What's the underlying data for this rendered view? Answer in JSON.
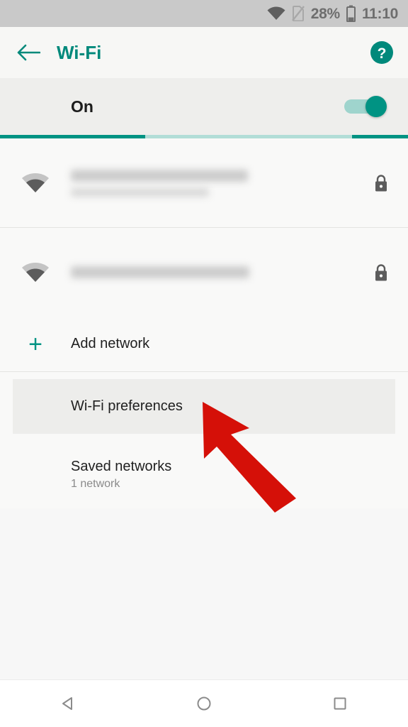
{
  "status_bar": {
    "wifi_icon": "wifi-icon",
    "sim_icon": "sim-card-off-icon",
    "battery_percent": "28%",
    "battery_icon": "battery-icon",
    "clock": "11:10"
  },
  "app_bar": {
    "back_icon": "arrow-back-icon",
    "title": "Wi-Fi",
    "help_icon": "help-circle-icon",
    "accent_color": "#00897b"
  },
  "master_switch": {
    "label": "On",
    "state": "on",
    "track_color": "#9fd4cd",
    "thumb_color": "#009383"
  },
  "progress": {
    "indeterminate": true,
    "color": "#009383",
    "track_color": "#b2ddd7"
  },
  "networks": [
    {
      "name": "",
      "name_redacted": true,
      "has_subtitle": true,
      "subtitle": "",
      "signal_icon": "wifi-signal-icon",
      "secure_icon": "lock-icon"
    },
    {
      "name": "",
      "name_redacted": true,
      "has_subtitle": false,
      "subtitle": "",
      "signal_icon": "wifi-signal-icon",
      "secure_icon": "lock-icon"
    }
  ],
  "actions": {
    "add_network": {
      "label": "Add network",
      "icon": "plus-icon",
      "icon_color": "#009383"
    },
    "wifi_preferences": {
      "label": "Wi-Fi preferences",
      "highlighted": true,
      "highlight_color": "#ededeb"
    },
    "saved_networks": {
      "label": "Saved networks",
      "subtitle": "1 network"
    }
  },
  "annotation": {
    "type": "arrow",
    "color": "#d51008",
    "points_to": "Wi-Fi preferences"
  },
  "nav_bar": {
    "back": "nav-back-icon",
    "home": "nav-home-icon",
    "recents": "nav-recents-icon"
  }
}
